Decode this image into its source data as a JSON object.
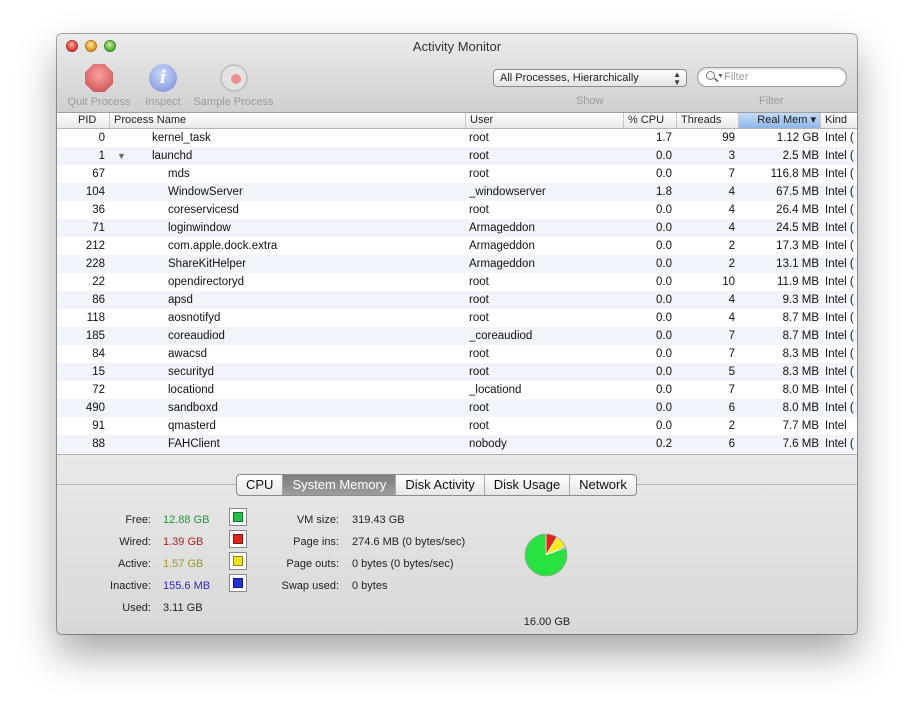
{
  "window": {
    "title": "Activity Monitor"
  },
  "toolbar": {
    "quit_label": "Quit Process",
    "inspect_label": "Inspect",
    "sample_label": "Sample Process",
    "inspect_glyph": "i",
    "show_value": "All Processes, Hierarchically",
    "show_label": "Show",
    "filter_placeholder": "Filter",
    "filter_label": "Filter"
  },
  "table": {
    "columns": [
      "PID",
      "Process Name",
      "User",
      "% CPU",
      "Threads",
      "Real Mem ▾",
      "Kind"
    ],
    "sorted_column": "Real Mem",
    "rows": [
      {
        "pid": "0",
        "name": "kernel_task",
        "user": "root",
        "cpu": "1.7",
        "threads": "99",
        "mem": "1.12 GB",
        "kind": "Intel (",
        "indent": 0,
        "tri": ""
      },
      {
        "pid": "1",
        "name": "launchd",
        "user": "root",
        "cpu": "0.0",
        "threads": "3",
        "mem": "2.5 MB",
        "kind": "Intel (",
        "indent": 0,
        "tri": "▼"
      },
      {
        "pid": "67",
        "name": "mds",
        "user": "root",
        "cpu": "0.0",
        "threads": "7",
        "mem": "116.8 MB",
        "kind": "Intel (",
        "indent": 1,
        "tri": ""
      },
      {
        "pid": "104",
        "name": "WindowServer",
        "user": "_windowserver",
        "cpu": "1.8",
        "threads": "4",
        "mem": "67.5 MB",
        "kind": "Intel (",
        "indent": 1,
        "tri": ""
      },
      {
        "pid": "36",
        "name": "coreservicesd",
        "user": "root",
        "cpu": "0.0",
        "threads": "4",
        "mem": "26.4 MB",
        "kind": "Intel (",
        "indent": 1,
        "tri": ""
      },
      {
        "pid": "71",
        "name": "loginwindow",
        "user": "Armageddon",
        "cpu": "0.0",
        "threads": "4",
        "mem": "24.5 MB",
        "kind": "Intel (",
        "indent": 1,
        "tri": ""
      },
      {
        "pid": "212",
        "name": "com.apple.dock.extra",
        "user": "Armageddon",
        "cpu": "0.0",
        "threads": "2",
        "mem": "17.3 MB",
        "kind": "Intel (",
        "indent": 1,
        "tri": ""
      },
      {
        "pid": "228",
        "name": "ShareKitHelper",
        "user": "Armageddon",
        "cpu": "0.0",
        "threads": "2",
        "mem": "13.1 MB",
        "kind": "Intel (",
        "indent": 1,
        "tri": ""
      },
      {
        "pid": "22",
        "name": "opendirectoryd",
        "user": "root",
        "cpu": "0.0",
        "threads": "10",
        "mem": "11.9 MB",
        "kind": "Intel (",
        "indent": 1,
        "tri": ""
      },
      {
        "pid": "86",
        "name": "apsd",
        "user": "root",
        "cpu": "0.0",
        "threads": "4",
        "mem": "9.3 MB",
        "kind": "Intel (",
        "indent": 1,
        "tri": ""
      },
      {
        "pid": "118",
        "name": "aosnotifyd",
        "user": "root",
        "cpu": "0.0",
        "threads": "4",
        "mem": "8.7 MB",
        "kind": "Intel (",
        "indent": 1,
        "tri": ""
      },
      {
        "pid": "185",
        "name": "coreaudiod",
        "user": "_coreaudiod",
        "cpu": "0.0",
        "threads": "7",
        "mem": "8.7 MB",
        "kind": "Intel (",
        "indent": 1,
        "tri": ""
      },
      {
        "pid": "84",
        "name": "awacsd",
        "user": "root",
        "cpu": "0.0",
        "threads": "7",
        "mem": "8.3 MB",
        "kind": "Intel (",
        "indent": 1,
        "tri": ""
      },
      {
        "pid": "15",
        "name": "securityd",
        "user": "root",
        "cpu": "0.0",
        "threads": "5",
        "mem": "8.3 MB",
        "kind": "Intel (",
        "indent": 1,
        "tri": ""
      },
      {
        "pid": "72",
        "name": "locationd",
        "user": "_locationd",
        "cpu": "0.0",
        "threads": "7",
        "mem": "8.0 MB",
        "kind": "Intel (",
        "indent": 1,
        "tri": ""
      },
      {
        "pid": "490",
        "name": "sandboxd",
        "user": "root",
        "cpu": "0.0",
        "threads": "6",
        "mem": "8.0 MB",
        "kind": "Intel (",
        "indent": 1,
        "tri": ""
      },
      {
        "pid": "91",
        "name": "qmasterd",
        "user": "root",
        "cpu": "0.0",
        "threads": "2",
        "mem": "7.7 MB",
        "kind": "Intel",
        "indent": 1,
        "tri": ""
      },
      {
        "pid": "88",
        "name": "FAHClient",
        "user": "nobody",
        "cpu": "0.2",
        "threads": "6",
        "mem": "7.6 MB",
        "kind": "Intel (",
        "indent": 1,
        "tri": ""
      }
    ]
  },
  "tabs": [
    {
      "label": "CPU",
      "active": false
    },
    {
      "label": "System Memory",
      "active": true
    },
    {
      "label": "Disk Activity",
      "active": false
    },
    {
      "label": "Disk Usage",
      "active": false
    },
    {
      "label": "Network",
      "active": false
    }
  ],
  "memory": {
    "free": {
      "label": "Free:",
      "value": "12.88 GB",
      "color": "#22c24a"
    },
    "wired": {
      "label": "Wired:",
      "value": "1.39 GB",
      "color": "#e0241c"
    },
    "active": {
      "label": "Active:",
      "value": "1.57 GB",
      "color": "#f2e21b"
    },
    "inactive": {
      "label": "Inactive:",
      "value": "155.6 MB",
      "color": "#2131d6"
    },
    "used": {
      "label": "Used:",
      "value": "3.11 GB"
    },
    "vm_size": {
      "label": "VM size:",
      "value": "319.43 GB"
    },
    "page_ins": {
      "label": "Page ins:",
      "value": "274.6 MB (0 bytes/sec)"
    },
    "page_outs": {
      "label": "Page outs:",
      "value": "0 bytes (0 bytes/sec)"
    },
    "swap_used": {
      "label": "Swap used:",
      "value": "0 bytes"
    },
    "total": "16.00 GB",
    "value_colors": {
      "free": "#1a9a2f",
      "wired": "#b01e1e",
      "active": "#9a9a22",
      "inactive": "#2b2bb0"
    },
    "pie_slices": [
      {
        "name": "Free",
        "value": 12.88,
        "color": "#27e23f"
      },
      {
        "name": "Wired",
        "value": 1.39,
        "color": "#e0241c"
      },
      {
        "name": "Active",
        "value": 1.57,
        "color": "#f4ec1e"
      },
      {
        "name": "Inactive",
        "value": 0.1556,
        "color": "#2131d6"
      }
    ]
  }
}
